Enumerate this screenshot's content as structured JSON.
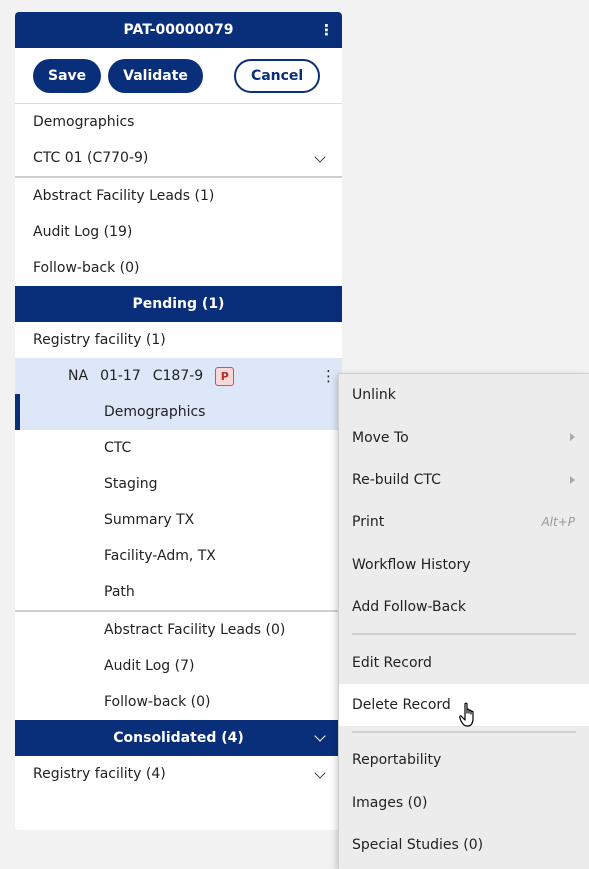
{
  "patient_id": "PAT-00000079",
  "toolbar": {
    "save": "Save",
    "validate": "Validate",
    "cancel": "Cancel"
  },
  "nav_top": {
    "demographics": "Demographics",
    "ctc": "CTC 01  (C770-9)"
  },
  "nav_links": [
    "Abstract Facility Leads (1)",
    "Audit Log (19)",
    "Follow-back (0)"
  ],
  "pending": {
    "header": "Pending (1)",
    "facility": "Registry facility  (1)",
    "record": {
      "status": "NA",
      "date": "01-17",
      "site": "C187-9",
      "badge": "P"
    },
    "record_items": [
      "Demographics",
      "CTC",
      "Staging",
      "Summary TX",
      "Facility-Adm, TX",
      "Path"
    ],
    "record_links": [
      "Abstract Facility Leads (0)",
      "Audit Log (7)",
      "Follow-back (0)"
    ]
  },
  "consolidated": {
    "header": "Consolidated (4)",
    "facility": "Registry facility  (4)"
  },
  "context_menu": {
    "unlink": "Unlink",
    "move_to": "Move To",
    "rebuild_ctc": "Re-build CTC",
    "print": "Print",
    "print_shortcut": "Alt+P",
    "workflow_history": "Workflow History",
    "add_follow_back": "Add Follow-Back",
    "edit_record": "Edit Record",
    "delete_record": "Delete Record",
    "reportability": "Reportability",
    "images": "Images (0)",
    "special_studies": "Special Studies (0)"
  },
  "colors": {
    "navy": "#0a2f7a",
    "selected_bg": "#dde7f7",
    "badge_border": "#c95454"
  }
}
